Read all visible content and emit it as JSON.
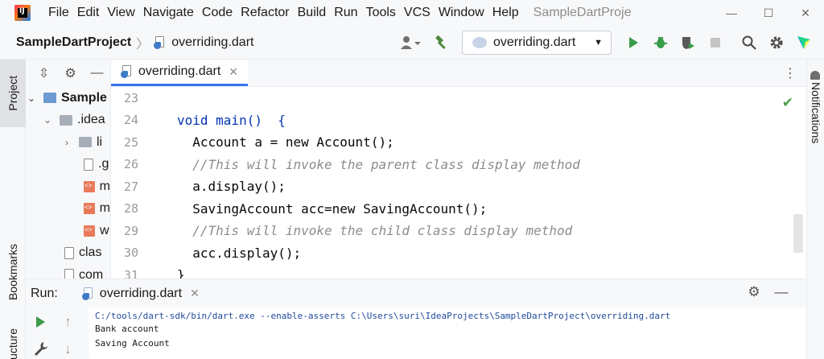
{
  "menubar": {
    "logo": "IJ",
    "items": [
      "File",
      "Edit",
      "View",
      "Navigate",
      "Code",
      "Refactor",
      "Build",
      "Run",
      "Tools",
      "VCS",
      "Window",
      "Help"
    ],
    "window_title": "SampleDartProje",
    "controls": [
      "—",
      "☐",
      "✕"
    ]
  },
  "navbar": {
    "project": "SampleDartProject",
    "file": "overriding.dart",
    "run_config": "overriding.dart",
    "icons": [
      "user-icon",
      "build-hammer-icon",
      "run-icon",
      "debug-icon",
      "coverage-icon",
      "stop-icon",
      "search-icon",
      "settings-icon",
      "toolbox-icon"
    ]
  },
  "left_strip": {
    "project_tab": "Project",
    "bookmarks_tab": "Bookmarks",
    "structure_tab": "ucture"
  },
  "right_strip": {
    "notifications_tab": "Notifications"
  },
  "project_tree": {
    "rows": [
      {
        "chevron": "⌄",
        "label": "Sample",
        "bold": true
      },
      {
        "chevron": "⌄",
        "label": ".idea"
      },
      {
        "chevron": "›",
        "label": "li"
      },
      {
        "chevron": "",
        "label": ".g"
      },
      {
        "chevron": "",
        "label": "m"
      },
      {
        "chevron": "",
        "label": "m"
      },
      {
        "chevron": "",
        "label": "w"
      },
      {
        "chevron": "",
        "label": "clas"
      },
      {
        "chevron": "",
        "label": "com"
      }
    ]
  },
  "editor": {
    "tab_label": "overriding.dart",
    "lines": [
      {
        "n": "23",
        "text": ""
      },
      {
        "n": "24",
        "text": "void main()  {"
      },
      {
        "n": "25",
        "text": "  Account a = new Account();"
      },
      {
        "n": "26",
        "text": "  //This will invoke the parent class display method"
      },
      {
        "n": "27",
        "text": "  a.display();"
      },
      {
        "n": "28",
        "text": "  SavingAccount acc=new SavingAccount();"
      },
      {
        "n": "29",
        "text": "  //This will invoke the child class display method"
      },
      {
        "n": "30",
        "text": "  acc.display();"
      },
      {
        "n": "31",
        "text": "}"
      }
    ]
  },
  "run_panel": {
    "title": "Run:",
    "tab_label": "overriding.dart",
    "console": [
      "C:/tools/dart-sdk/bin/dart.exe --enable-asserts C:\\Users\\suri\\IdeaProjects\\SampleDartProject\\overriding.dart",
      "Bank account",
      "Saving Account"
    ]
  }
}
